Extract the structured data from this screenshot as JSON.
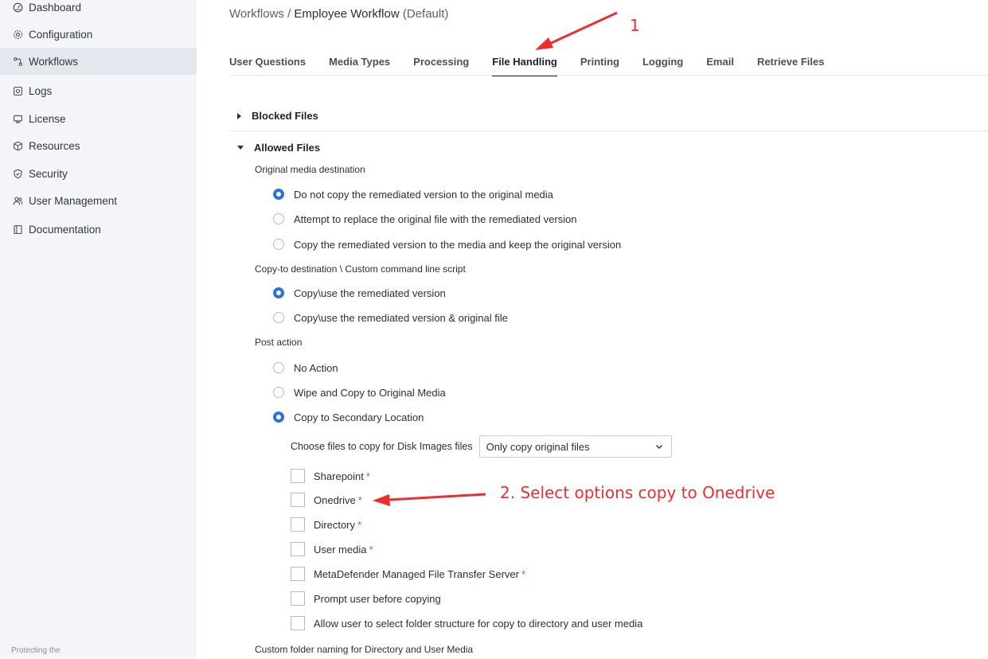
{
  "sidebar": {
    "items": [
      {
        "label": "Dashboard",
        "icon": "dashboard-icon",
        "active": false
      },
      {
        "label": "Configuration",
        "icon": "gear-icon",
        "active": false
      },
      {
        "label": "Workflows",
        "icon": "workflow-icon",
        "active": true
      },
      {
        "label": "Logs",
        "icon": "logs-icon",
        "active": false
      },
      {
        "label": "License",
        "icon": "license-icon",
        "active": false
      },
      {
        "label": "Resources",
        "icon": "cube-icon",
        "active": false
      },
      {
        "label": "Security",
        "icon": "shield-icon",
        "active": false
      },
      {
        "label": "User Management",
        "icon": "users-icon",
        "active": false
      },
      {
        "label": "Documentation",
        "icon": "book-icon",
        "active": false
      }
    ],
    "footer": "Protecting the"
  },
  "breadcrumb": {
    "root": "Workflows",
    "separator": "/",
    "current": "Employee Workflow",
    "suffix": "(Default)"
  },
  "tabs": [
    {
      "label": "User Questions",
      "active": false
    },
    {
      "label": "Media Types",
      "active": false
    },
    {
      "label": "Processing",
      "active": false
    },
    {
      "label": "File Handling",
      "active": true
    },
    {
      "label": "Printing",
      "active": false
    },
    {
      "label": "Logging",
      "active": false
    },
    {
      "label": "Email",
      "active": false
    },
    {
      "label": "Retrieve Files",
      "active": false
    }
  ],
  "blocked_files": {
    "label": "Blocked Files",
    "expanded": false
  },
  "allowed_files": {
    "label": "Allowed Files",
    "expanded": true,
    "original_media": {
      "label": "Original media destination",
      "options": [
        {
          "label": "Do not copy the remediated version to the original media",
          "checked": true
        },
        {
          "label": "Attempt to replace the original file with the remediated version",
          "checked": false
        },
        {
          "label": "Copy the remediated version to the media and keep the original version",
          "checked": false
        }
      ]
    },
    "copy_to": {
      "label": "Copy-to destination \\ Custom command line script",
      "options": [
        {
          "label": "Copy\\use the remediated version",
          "checked": true
        },
        {
          "label": "Copy\\use the remediated version & original file",
          "checked": false
        }
      ]
    },
    "post_action": {
      "label": "Post action",
      "options": [
        {
          "label": "No Action",
          "checked": false
        },
        {
          "label": "Wipe and Copy to Original Media",
          "checked": false
        },
        {
          "label": "Copy to Secondary Location",
          "checked": true
        }
      ]
    },
    "disk_images": {
      "label": "Choose files to copy for Disk Images files",
      "selected": "Only copy original files"
    },
    "checkboxes": [
      {
        "label": "Sharepoint",
        "required": true,
        "checked": false
      },
      {
        "label": "Onedrive",
        "required": true,
        "checked": false
      },
      {
        "label": "Directory",
        "required": true,
        "checked": false
      },
      {
        "label": "User media",
        "required": true,
        "checked": false
      },
      {
        "label": "MetaDefender Managed File Transfer Server",
        "required": true,
        "checked": false
      },
      {
        "label": "Prompt user before copying",
        "required": false,
        "checked": false
      },
      {
        "label": "Allow user to select folder structure for copy to directory and user media",
        "required": false,
        "checked": false
      }
    ],
    "required_mark": "*",
    "custom_folder_label": "Custom folder naming for Directory and User Media"
  },
  "annotations": {
    "step1": "1",
    "step2": "2. Select options copy to Onedrive",
    "color": "#ee2e2e"
  }
}
